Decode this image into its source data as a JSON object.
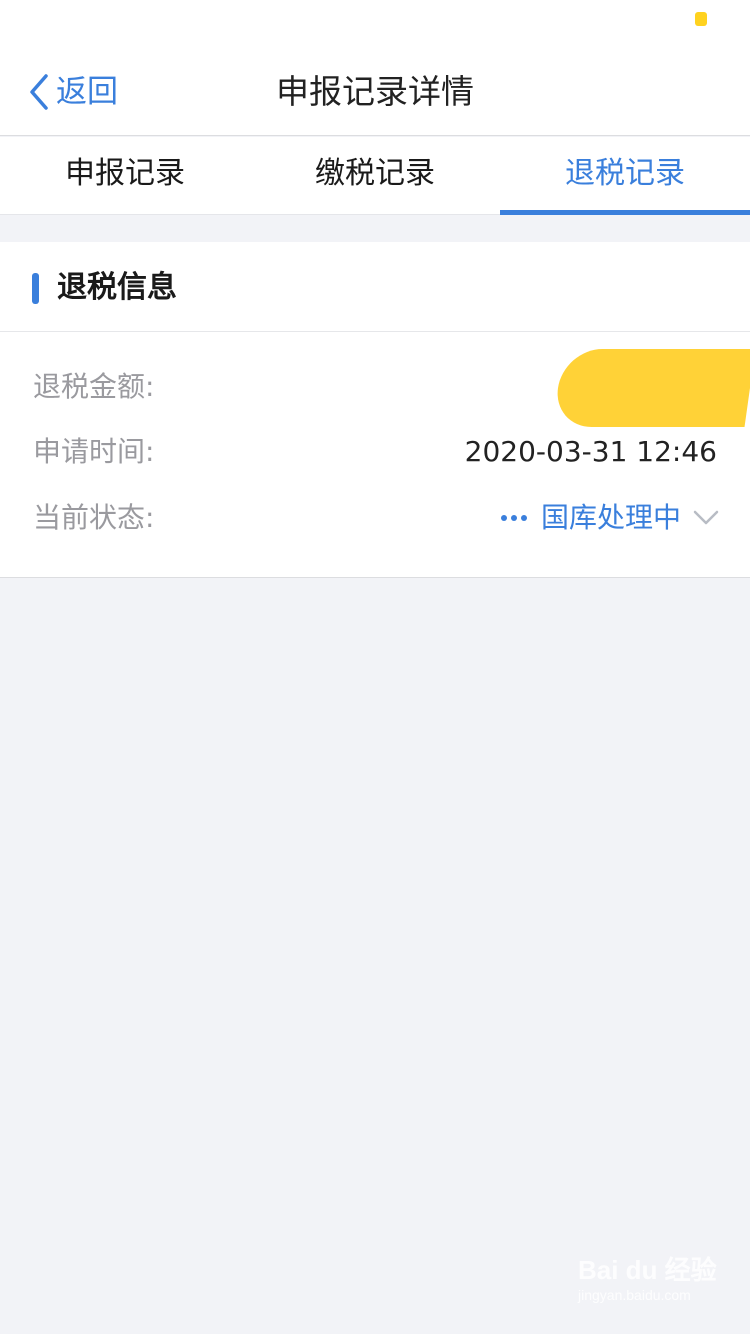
{
  "nav": {
    "back_label": "返回",
    "title": "申报记录详情"
  },
  "tabs": [
    {
      "label": "申报记录",
      "active": false
    },
    {
      "label": "缴税记录",
      "active": false
    },
    {
      "label": "退税记录",
      "active": true
    }
  ],
  "refund_info": {
    "section_title": "退税信息",
    "rows": [
      {
        "label": "退税金额:",
        "value": ""
      },
      {
        "label": "申请时间:",
        "value": "2020-03-31 12:46"
      },
      {
        "label": "当前状态:",
        "value": "国库处理中"
      }
    ]
  },
  "watermark": {
    "logo": "Bai du 经验",
    "url": "jingyan.baidu.com"
  },
  "colors": {
    "accent": "#3a7fdc",
    "redaction": "#ffd02c",
    "background": "#f2f3f7"
  }
}
